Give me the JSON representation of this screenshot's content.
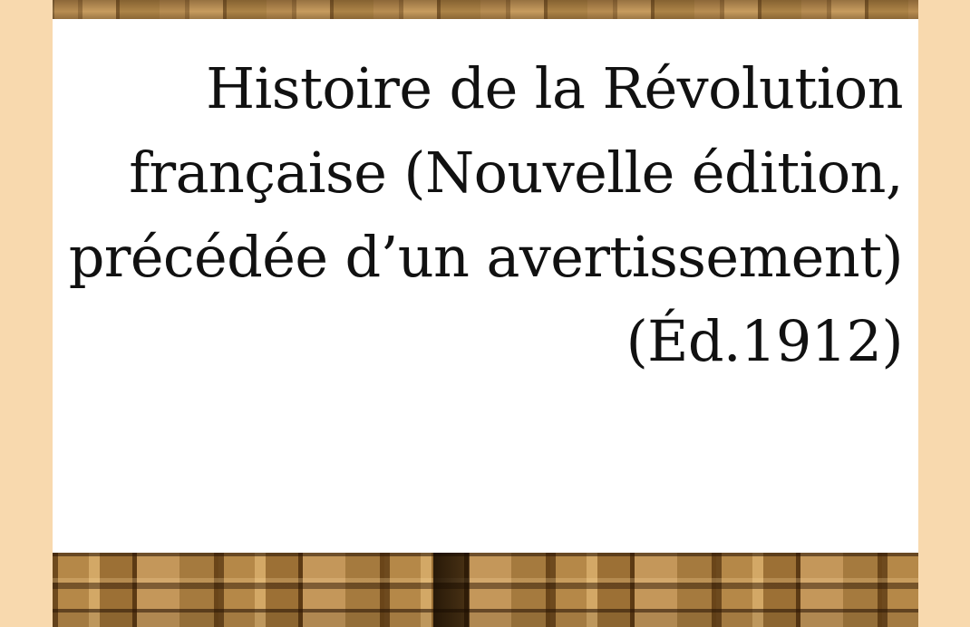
{
  "cover": {
    "title_lines": [
      "Histoire de la Révolution",
      "française (Nouvelle édition,",
      "précédée d’un avertissement)",
      "(Éd.1912)"
    ]
  },
  "colors": {
    "margin_background": "#f8d9ae",
    "title_panel": "#ffffff",
    "title_text": "#111111",
    "bookshelf_brown": "#a67c43"
  }
}
